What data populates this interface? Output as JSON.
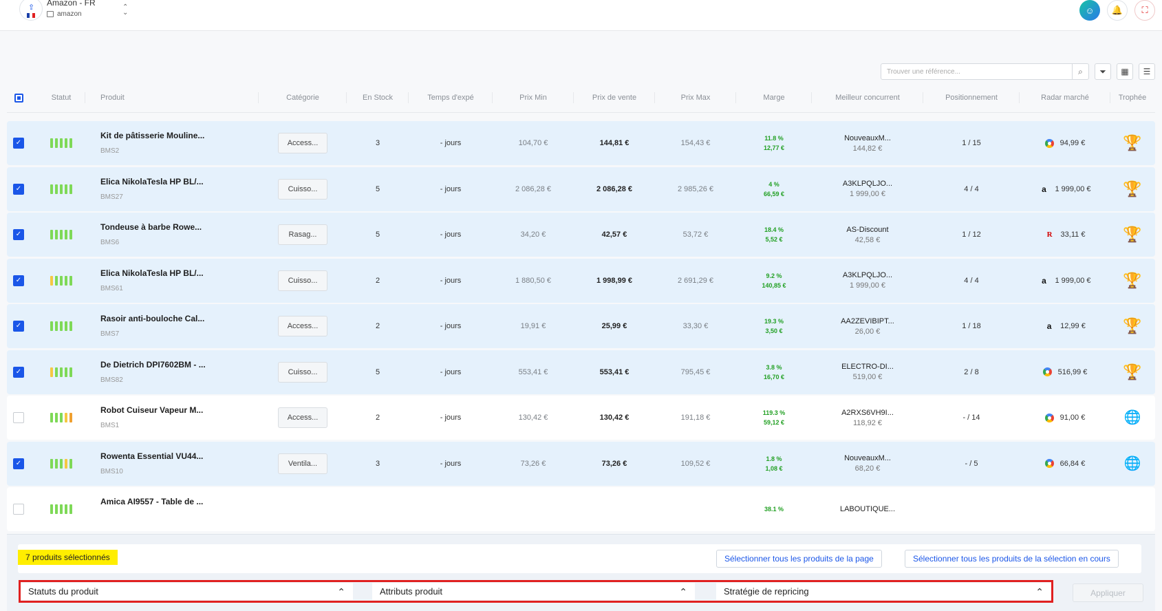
{
  "header": {
    "shop_name": "Amazon - FR",
    "shop_sub": "amazon",
    "flag_colors": [
      "#1a3fa8",
      "#ffffff",
      "#e02020"
    ]
  },
  "toolbar": {
    "search_placeholder": "Trouver une référence...",
    "icons": [
      "search-icon",
      "filter-icon",
      "grid-icon",
      "list-icon"
    ]
  },
  "table": {
    "headers": {
      "statut": "Statut",
      "produit": "Produit",
      "categorie": "Catégorie",
      "stock": "En Stock",
      "temps": "Temps d'expé",
      "prix_min": "Prix Min",
      "prix_vente": "Prix de vente",
      "prix_max": "Prix Max",
      "marge": "Marge",
      "concurrent": "Meilleur concurrent",
      "position": "Positionnement",
      "radar": "Radar marché",
      "trophee": "Trophée"
    },
    "rows": [
      {
        "selected": true,
        "bars": [
          "g",
          "g",
          "g",
          "g",
          "g"
        ],
        "name": "Kit de pâtisserie Mouline...",
        "sku": "BMS2",
        "category": "Access...",
        "stock": "3",
        "delay": "- jours",
        "prix_min": "104,70 €",
        "prix_vente": "144,81 €",
        "prix_max": "154,43 €",
        "marge_pct": "11.8 %",
        "marge_val": "12,77 €",
        "comp_name": "NouveauxM...",
        "comp_price": "144,82 €",
        "position": "1 / 15",
        "radar_logo": "google",
        "radar_price": "94,99 €",
        "trophy": true
      },
      {
        "selected": true,
        "bars": [
          "g",
          "g",
          "g",
          "g",
          "g"
        ],
        "name": "Elica NikolaTesla HP BL/...",
        "sku": "BMS27",
        "category": "Cuisso...",
        "stock": "5",
        "delay": "- jours",
        "prix_min": "2 086,28 €",
        "prix_vente": "2 086,28 €",
        "prix_max": "2 985,26 €",
        "marge_pct": "4 %",
        "marge_val": "66,59 €",
        "comp_name": "A3KLPQLJO...",
        "comp_price": "1 999,00 €",
        "position": "4 / 4",
        "radar_logo": "amazon",
        "radar_price": "1 999,00 €",
        "trophy": true
      },
      {
        "selected": true,
        "bars": [
          "g",
          "g",
          "g",
          "g",
          "g"
        ],
        "name": "Tondeuse à barbe Rowe...",
        "sku": "BMS6",
        "category": "Rasag...",
        "stock": "5",
        "delay": "- jours",
        "prix_min": "34,20 €",
        "prix_vente": "42,57 €",
        "prix_max": "53,72 €",
        "marge_pct": "18.4 %",
        "marge_val": "5,52 €",
        "comp_name": "AS-Discount",
        "comp_price": "42,58 €",
        "position": "1 / 12",
        "radar_logo": "rakuten",
        "radar_price": "33,11 €",
        "trophy": true
      },
      {
        "selected": true,
        "bars": [
          "y",
          "g",
          "g",
          "g",
          "g"
        ],
        "name": "Elica NikolaTesla HP BL/...",
        "sku": "BMS61",
        "category": "Cuisso...",
        "stock": "2",
        "delay": "- jours",
        "prix_min": "1 880,50 €",
        "prix_vente": "1 998,99 €",
        "prix_max": "2 691,29 €",
        "marge_pct": "9.2 %",
        "marge_val": "140,85 €",
        "comp_name": "A3KLPQLJO...",
        "comp_price": "1 999,00 €",
        "position": "4 / 4",
        "radar_logo": "amazon",
        "radar_price": "1 999,00 €",
        "trophy": true
      },
      {
        "selected": true,
        "bars": [
          "g",
          "g",
          "g",
          "g",
          "g"
        ],
        "name": "Rasoir anti-bouloche Cal...",
        "sku": "BMS7",
        "category": "Access...",
        "stock": "2",
        "delay": "- jours",
        "prix_min": "19,91 €",
        "prix_vente": "25,99 €",
        "prix_max": "33,30 €",
        "marge_pct": "19.3 %",
        "marge_val": "3,50 €",
        "comp_name": "AA2ZEVIBIPT...",
        "comp_price": "26,00 €",
        "position": "1 / 18",
        "radar_logo": "amazon",
        "radar_price": "12,99 €",
        "trophy": true
      },
      {
        "selected": true,
        "bars": [
          "y",
          "g",
          "g",
          "g",
          "g"
        ],
        "name": "De Dietrich DPI7602BM - ...",
        "sku": "BMS82",
        "category": "Cuisso...",
        "stock": "5",
        "delay": "- jours",
        "prix_min": "553,41 €",
        "prix_vente": "553,41 €",
        "prix_max": "795,45 €",
        "marge_pct": "3.8 %",
        "marge_val": "16,70 €",
        "comp_name": "ELECTRO-DI...",
        "comp_price": "519,00 €",
        "position": "2 / 8",
        "radar_logo": "google",
        "radar_price": "516,99 €",
        "trophy": true
      },
      {
        "selected": false,
        "bars": [
          "g",
          "g",
          "g",
          "y",
          "o"
        ],
        "name": "Robot Cuiseur Vapeur M...",
        "sku": "BMS1",
        "category": "Access...",
        "stock": "2",
        "delay": "- jours",
        "prix_min": "130,42 €",
        "prix_vente": "130,42 €",
        "prix_max": "191,18 €",
        "marge_pct": "119.3 %",
        "marge_val": "59,12 €",
        "comp_name": "A2RXS6VH9I...",
        "comp_price": "118,92 €",
        "position": "- / 14",
        "radar_logo": "google",
        "radar_price": "91,00 €",
        "trophy": false
      },
      {
        "selected": true,
        "bars": [
          "g",
          "g",
          "g",
          "y",
          "g"
        ],
        "name": "Rowenta Essential VU44...",
        "sku": "BMS10",
        "category": "Ventila...",
        "stock": "3",
        "delay": "- jours",
        "prix_min": "73,26 €",
        "prix_vente": "73,26 €",
        "prix_max": "109,52 €",
        "marge_pct": "1.8 %",
        "marge_val": "1,08 €",
        "comp_name": "NouveauxM...",
        "comp_price": "68,20 €",
        "position": "- / 5",
        "radar_logo": "google",
        "radar_price": "66,84 €",
        "trophy": false
      },
      {
        "selected": false,
        "bars": [
          "g",
          "g",
          "g",
          "g",
          "g"
        ],
        "name": "Amica AI9557 - Table de ...",
        "sku": "",
        "category": "",
        "stock": "",
        "delay": "",
        "prix_min": "",
        "prix_vente": "",
        "prix_max": "",
        "marge_pct": "38.1 %",
        "marge_val": "",
        "comp_name": "LABOUTIQUE...",
        "comp_price": "",
        "position": "",
        "radar_logo": "",
        "radar_price": "",
        "trophy": false
      }
    ]
  },
  "bottom": {
    "selected_count": "7 produits sélectionnés",
    "select_page": "Sélectionner tous les produits de la page",
    "select_all": "Sélectionner tous les produits de la sélection en cours",
    "filter1": "Statuts du produit",
    "filter2": "Attributs produit",
    "filter3": "Stratégie de repricing",
    "apply": "Appliquer"
  },
  "colors": {
    "accent": "#1a56e8",
    "bar_green": "#7ed957",
    "bar_yellow": "#f5c842",
    "bar_orange": "#f0a030",
    "margin_green": "#22a023",
    "highlight": "#ffee00",
    "filter_border": "#e02020"
  }
}
